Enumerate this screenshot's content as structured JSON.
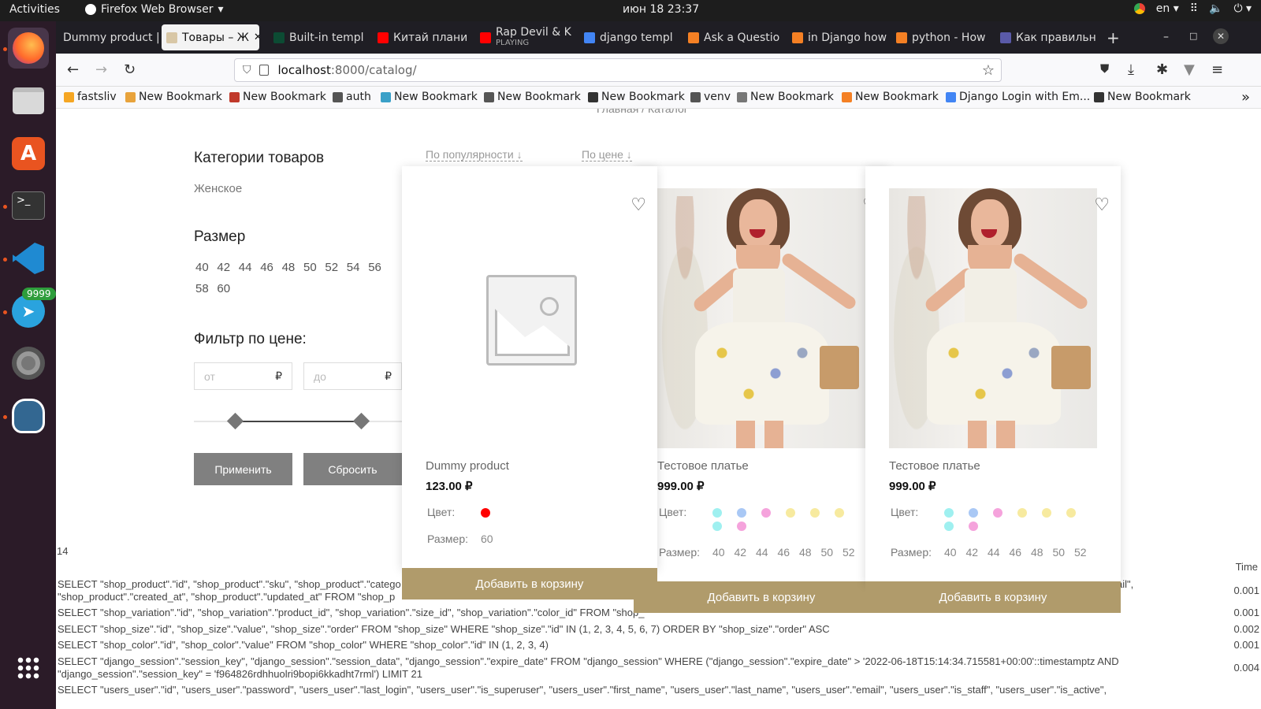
{
  "topbar": {
    "activities": "Activities",
    "app_name": "Firefox Web Browser",
    "clock": "июн 18  23:37",
    "lang": "en"
  },
  "dock": {
    "telegram_badge": "9999"
  },
  "tabs": [
    {
      "label": "Dummy product |",
      "color": "#aaa"
    },
    {
      "label": "Товары – Ж",
      "color": "#d8c7a6"
    },
    {
      "label": "Built-in templ",
      "color": "#0c4b33"
    },
    {
      "label": "Китай плани",
      "color": "#ff0000"
    },
    {
      "label": "Rap Devil & K",
      "sub": "PLAYING",
      "color": "#ff0000"
    },
    {
      "label": "django templ",
      "color": "#4285f4"
    },
    {
      "label": "Ask a Questio",
      "color": "#f48024"
    },
    {
      "label": "in Django how",
      "color": "#f48024"
    },
    {
      "label": "python - How",
      "color": "#f48024"
    },
    {
      "label": "Как правильн",
      "color": "#5a5aa8"
    }
  ],
  "nav": {
    "url_host": "localhost",
    "url_rest": ":8000/catalog/"
  },
  "bookmarks": [
    {
      "label": "fastsliv",
      "color": "#f5a623"
    },
    {
      "label": "New Bookmark",
      "color": "#e8a33c"
    },
    {
      "label": "New Bookmark",
      "color": "#c0392b"
    },
    {
      "label": "auth",
      "color": "#555"
    },
    {
      "label": "New Bookmark",
      "color": "#3aa0c8"
    },
    {
      "label": "New Bookmark",
      "color": "#555"
    },
    {
      "label": "New Bookmark",
      "color": "#333"
    },
    {
      "label": "venv",
      "color": "#555"
    },
    {
      "label": "New Bookmark",
      "color": "#777"
    },
    {
      "label": "New Bookmark",
      "color": "#f48024"
    },
    {
      "label": "Django Login with Em...",
      "color": "#4285f4"
    },
    {
      "label": "New Bookmark",
      "color": "#333"
    }
  ],
  "page": {
    "breadcrumb": "Главная  /  Каталог",
    "categories_title": "Категории товаров",
    "category_item": "Женское",
    "size_title": "Размер",
    "sizes_row1": [
      "40",
      "42",
      "44",
      "46",
      "48",
      "50",
      "52",
      "54",
      "56"
    ],
    "sizes_row2": [
      "58",
      "60"
    ],
    "price_title": "Фильтр по цене:",
    "price_from_placeholder": "от",
    "price_to_placeholder": "до",
    "currency": "₽",
    "apply_label": "Применить",
    "reset_label": "Сбросить",
    "sort_popular": "По популярности",
    "sort_price": "По цене"
  },
  "products": [
    {
      "name": "Dummy product",
      "price": "123.00 ₽",
      "color_label": "Цвет:",
      "size_label": "Размер:",
      "colors": [
        "#ff0000"
      ],
      "sizes": [
        "60"
      ],
      "cart_label": "Добавить в корзину"
    },
    {
      "name": "Тестовое платье",
      "price": "999.00 ₽",
      "color_label": "Цвет:",
      "size_label": "Размер:",
      "colors": [
        "#9ff0f0",
        "#a9c8f5",
        "#f5a3dc",
        "#f7ea9f",
        "#f7ea9f",
        "#f7ea9f",
        "#9ff0f0",
        "#f5a3dc"
      ],
      "sizes": [
        "40",
        "42",
        "44",
        "46",
        "48",
        "50",
        "52"
      ],
      "cart_label": "Добавить в корзину"
    },
    {
      "name": "Тестовое платье",
      "price": "999.00 ₽",
      "color_label": "Цвет:",
      "size_label": "Размер:",
      "colors": [
        "#9ff0f0",
        "#a9c8f5",
        "#f5a3dc",
        "#f7ea9f",
        "#f7ea9f",
        "#f7ea9f",
        "#9ff0f0",
        "#f5a3dc"
      ],
      "sizes": [
        "40",
        "42",
        "44",
        "46",
        "48",
        "50",
        "52"
      ],
      "cart_label": "Добавить в корзину"
    }
  ],
  "debug": {
    "count": "14",
    "time_header": "Time",
    "queries": [
      {
        "text": "SELECT \"shop_product\".\"id\", \"shop_product\".\"sku\", \"shop_product\".\"catego",
        "text_right": "ail\",",
        "text2": "\"shop_product\".\"created_at\", \"shop_product\".\"updated_at\" FROM \"shop_p",
        "time": "0.001"
      },
      {
        "text": "SELECT \"shop_variation\".\"id\", \"shop_variation\".\"product_id\", \"shop_variation\".\"size_id\", \"shop_variation\".\"color_id\" FROM \"shop_",
        "time": "0.001"
      },
      {
        "text": "SELECT \"shop_size\".\"id\", \"shop_size\".\"value\", \"shop_size\".\"order\" FROM \"shop_size\" WHERE \"shop_size\".\"id\" IN (1, 2, 3, 4, 5, 6, 7) ORDER BY \"shop_size\".\"order\" ASC",
        "time": "0.002"
      },
      {
        "text": "SELECT \"shop_color\".\"id\", \"shop_color\".\"value\" FROM \"shop_color\" WHERE \"shop_color\".\"id\" IN (1, 2, 3, 4)",
        "time": "0.001"
      },
      {
        "text": "SELECT \"django_session\".\"session_key\", \"django_session\".\"session_data\", \"django_session\".\"expire_date\" FROM \"django_session\" WHERE (\"django_session\".\"expire_date\" > '2022-06-18T15:14:34.715581+00:00'::timestamptz AND",
        "text2": "\"django_session\".\"session_key\" = 'f964826rdhhuolri9bopi6kkadht7rml') LIMIT 21",
        "time": "0.004"
      },
      {
        "text": "SELECT \"users_user\".\"id\", \"users_user\".\"password\", \"users_user\".\"last_login\", \"users_user\".\"is_superuser\", \"users_user\".\"first_name\", \"users_user\".\"last_name\", \"users_user\".\"email\", \"users_user\".\"is_staff\", \"users_user\".\"is_active\",",
        "time": ""
      }
    ]
  }
}
